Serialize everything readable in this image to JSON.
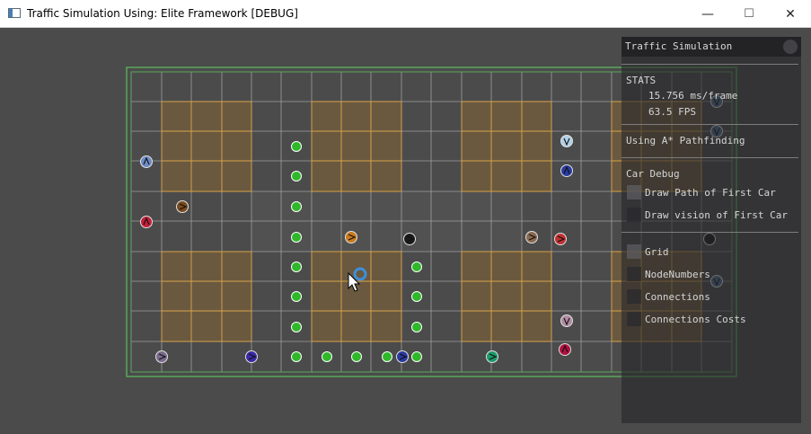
{
  "window": {
    "title": "Traffic Simulation Using: Elite Framework [DEBUG]",
    "minimize_glyph": "—",
    "maximize_glyph": "☐",
    "close_glyph": "✕"
  },
  "panel": {
    "title": "Traffic Simulation",
    "stats_header": "STATS",
    "ms_per_frame": "15.756 ms/frame",
    "fps": "63.5 FPS",
    "pathfinding": "Using A* Pathfinding",
    "car_debug_header": "Car Debug",
    "options": [
      {
        "label": "Draw Path of First Car",
        "checked": false
      },
      {
        "label": "Draw vision of First Car",
        "checked": false
      },
      {
        "label": "Grid",
        "checked": false
      },
      {
        "label": "NodeNumbers",
        "checked": false
      },
      {
        "label": "Connections",
        "checked": false
      },
      {
        "label": "Connections Costs",
        "checked": false
      }
    ]
  },
  "colors": {
    "background": "#4b4b4b",
    "block_fill": "#6b5a3e",
    "block_line": "#d8a248",
    "grid_line": "#b9b9b9",
    "border_line": "#5aa85a",
    "path_node": "#2fb82a",
    "target_ring": "#3d8fd9"
  },
  "cars": [
    {
      "color": "#6d8cc4",
      "icon": "car-icon"
    },
    {
      "color": "#7a4a1d",
      "icon": "car-icon"
    },
    {
      "color": "#c0203a",
      "icon": "car-icon"
    },
    {
      "color": "#7a6a8a",
      "icon": "car-icon"
    },
    {
      "color": "#3b2aa6",
      "icon": "car-icon"
    },
    {
      "color": "#c97a1a",
      "icon": "car-icon"
    },
    {
      "color": "#1a1a1a",
      "icon": "car-icon"
    },
    {
      "color": "#2a3aa0",
      "icon": "car-icon"
    },
    {
      "color": "#1e9a6a",
      "icon": "car-icon"
    },
    {
      "color": "#8a6a50",
      "icon": "car-icon"
    },
    {
      "color": "#c03030",
      "icon": "car-icon"
    },
    {
      "color": "#b0d0e8",
      "icon": "car-icon"
    },
    {
      "color": "#2a3aa0",
      "icon": "car-icon"
    },
    {
      "color": "#b08aa0",
      "icon": "car-icon"
    },
    {
      "color": "#b01040",
      "icon": "car-icon"
    },
    {
      "color": "#1a1a1a",
      "icon": "car-icon"
    },
    {
      "color": "#4a6a8a",
      "icon": "car-icon"
    },
    {
      "color": "#4a6a8a",
      "icon": "car-icon"
    },
    {
      "color": "#4a6a8a",
      "icon": "car-icon"
    }
  ]
}
